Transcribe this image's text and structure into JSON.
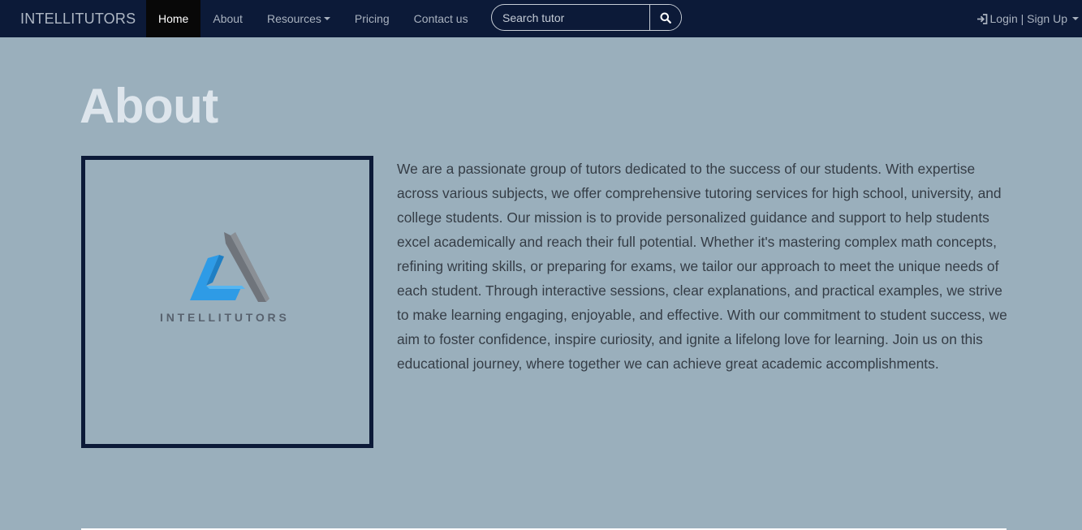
{
  "navbar": {
    "brand": "INTELLITUTORS",
    "links": [
      {
        "label": "Home",
        "active": true
      },
      {
        "label": "About"
      },
      {
        "label": "Resources",
        "dropdown": true
      },
      {
        "label": "Pricing"
      },
      {
        "label": "Contact us"
      }
    ],
    "search": {
      "placeholder": "Search tutor",
      "value": "",
      "icon": "search-icon"
    },
    "account": {
      "label": "Login | Sign Up",
      "icon": "login-icon",
      "dropdown": true
    }
  },
  "about": {
    "title": "About",
    "logo": {
      "wordmark": "INTELLITUTORS"
    },
    "body": "We are a passionate group of tutors dedicated to the success of our students. With expertise across various subjects, we offer comprehensive tutoring services for high school, university, and college students. Our mission is to provide personalized guidance and support to help students excel academically and reach their full potential. Whether it's mastering complex math concepts, refining writing skills, or preparing for exams, we tailor our approach to meet the unique needs of each student. Through interactive sessions, clear explanations, and practical examples, we strive to make learning engaging, enjoyable, and effective. With our commitment to student success, we aim to foster confidence, inspire curiosity, and ignite a lifelong love for learning. Join us on this educational journey, where together we can achieve great academic accomplishments."
  },
  "colors": {
    "navbar_bg": "#0c1a38",
    "page_bg": "#9aafbc",
    "active_tab_bg": "#080808",
    "logo_blue": "#2e9be6",
    "logo_gray": "#6f747b"
  }
}
